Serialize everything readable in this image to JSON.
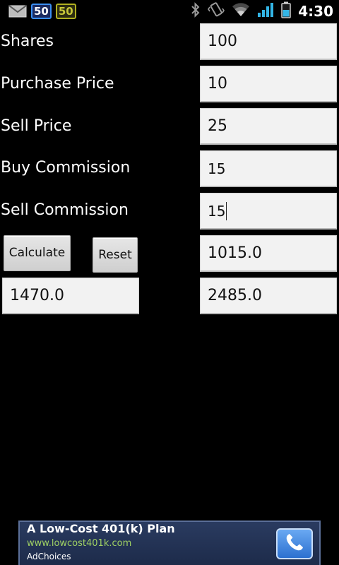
{
  "status_bar": {
    "left_icons": [
      "mail-icon"
    ],
    "badge_1": "50",
    "badge_2": "50",
    "right_icons": [
      "bluetooth-icon",
      "vibrate-icon",
      "wifi-icon",
      "signal-icon",
      "battery-icon"
    ],
    "time": "4:30"
  },
  "form": {
    "shares": {
      "label": "Shares",
      "value": "100"
    },
    "purchase_price": {
      "label": "Purchase Price",
      "value": "10"
    },
    "sell_price": {
      "label": "Sell Price",
      "value": "25"
    },
    "buy_commission": {
      "label": "Buy Commission",
      "value": "15"
    },
    "sell_commission": {
      "label": "Sell Commission",
      "value": "15"
    }
  },
  "buttons": {
    "calculate": "Calculate",
    "reset": "Reset"
  },
  "results": {
    "cost": "1015.0",
    "profit": "1470.0",
    "proceeds": "2485.0"
  },
  "ad": {
    "title": "A Low-Cost 401(k) Plan",
    "url": "www.lowcost401k.com",
    "choices": "AdChoices",
    "call_icon": "phone-icon"
  },
  "colors": {
    "background": "#000000",
    "field_bg": "#f2f2f2",
    "ad_bg": "#22314f",
    "ad_url": "#9fd063",
    "call_button": "#3b82e0"
  }
}
